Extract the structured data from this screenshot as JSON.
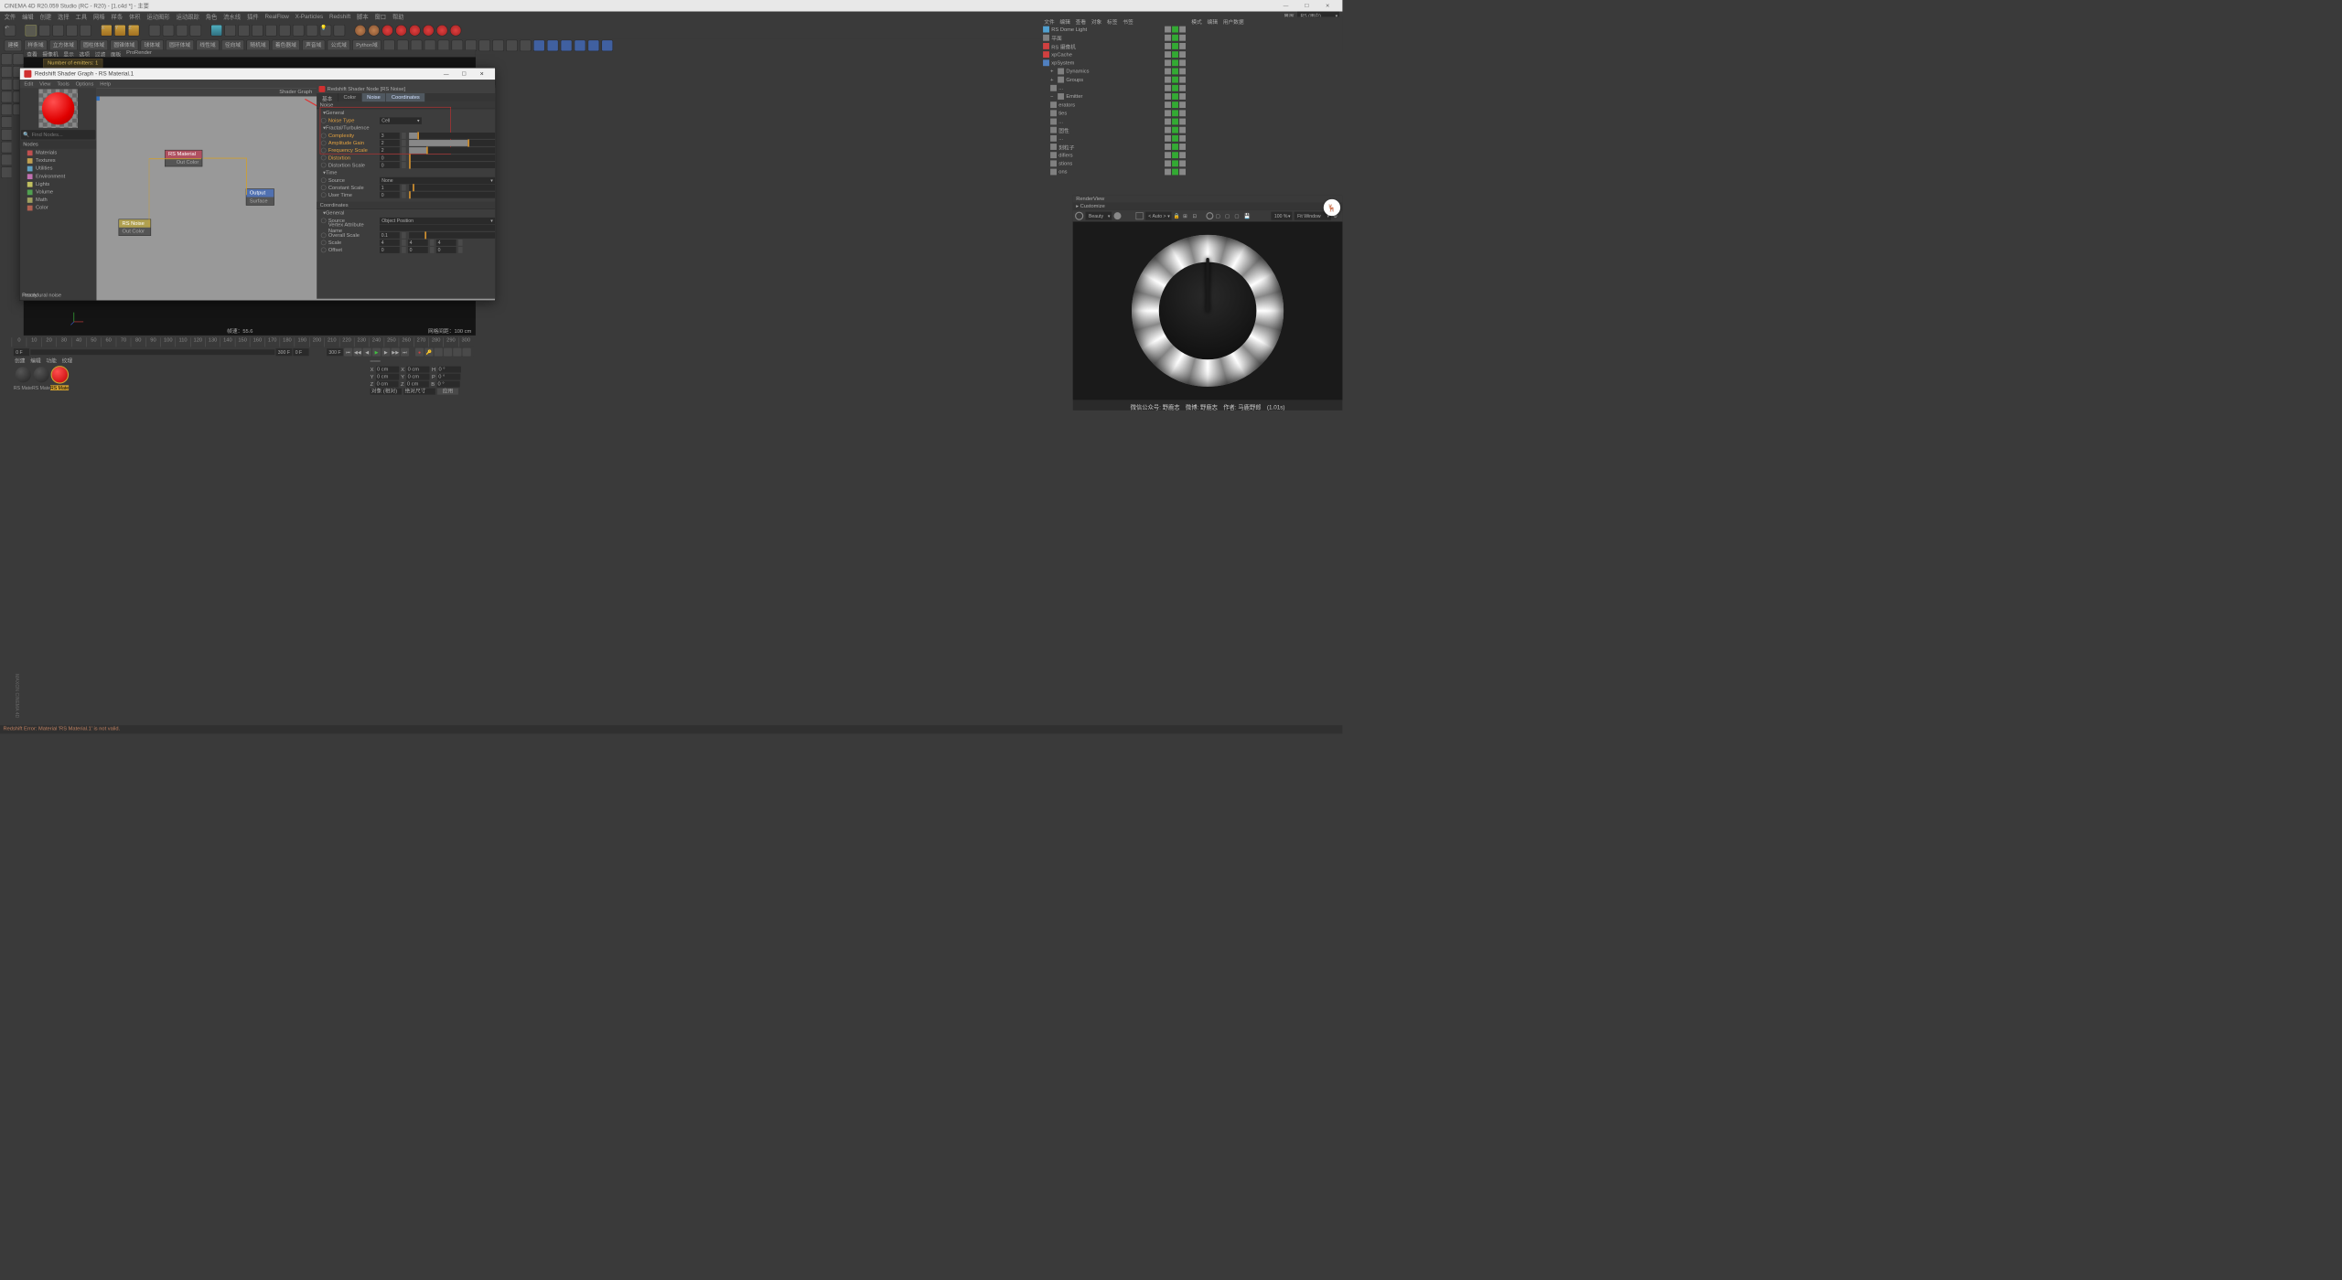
{
  "app": {
    "title": "CINEMA 4D R20.059 Studio (RC - R20) - [1.c4d *] - 主要",
    "layout_label": "界面",
    "layout_value": "RS (用户)"
  },
  "main_menu": [
    "文件",
    "编辑",
    "创建",
    "选择",
    "工具",
    "网格",
    "样条",
    "体积",
    "运动图形",
    "运动跟踪",
    "角色",
    "流水线",
    "插件",
    "RealFlow",
    "X-Particles",
    "Redshift",
    "脚本",
    "窗口",
    "帮助"
  ],
  "palette_row": [
    "建模",
    "样条域",
    "立方体域",
    "圆柱体域",
    "圆锥体域",
    "球体域",
    "圆环体域",
    "线性域",
    "径向域",
    "随机域",
    "着色器域",
    "声音域",
    "公式域",
    "Python域"
  ],
  "viewport": {
    "menu": [
      "查看",
      "摄像机",
      "显示",
      "选项",
      "过滤",
      "面板",
      "ProRender"
    ],
    "banner": "Number of emitters: 1",
    "fps": "帧速：55.6",
    "grid": "网格间距：100 cm",
    "axis_x": "X",
    "axis_y": "Y",
    "axis_z": "Z"
  },
  "shader": {
    "title": "Redshift Shader Graph - RS Material.1",
    "menu": [
      "Edit",
      "View",
      "Tools",
      "Options",
      "Help"
    ],
    "find_label": "Find Nodes...",
    "nodes_header": "Nodes",
    "categories": [
      {
        "label": "Materials",
        "color": "#c05050"
      },
      {
        "label": "Textures",
        "color": "#c0a050"
      },
      {
        "label": "Utilities",
        "color": "#60a0c0"
      },
      {
        "label": "Environment",
        "color": "#c070b0"
      },
      {
        "label": "Lights",
        "color": "#c0c060"
      },
      {
        "label": "Volume",
        "color": "#50a050"
      },
      {
        "label": "Math",
        "color": "#a0a060"
      },
      {
        "label": "Color",
        "color": "#b06050"
      }
    ],
    "graph_title": "Shader Graph",
    "nodes": {
      "rsnoise": {
        "title": "RS Noise",
        "out": "Out Color"
      },
      "rsmat": {
        "title": "RS Material",
        "out": "Out Color"
      },
      "output": {
        "title": "Output",
        "in": "Surface"
      }
    },
    "procedural": "Procedural noise",
    "ready": "Ready"
  },
  "node_panel": {
    "title": "Redshift Shader Node [RS Noise]",
    "tabs": [
      "基本",
      "Color",
      "Noise",
      "Coordinates"
    ],
    "active_tabs": [
      "Noise",
      "Coordinates"
    ],
    "noise_header": "Noise",
    "general": "General",
    "noise_type_label": "Noise Type",
    "noise_type": "Cell",
    "fractal_header": "Fractal/Turbulence",
    "complexity_label": "Complexity",
    "complexity": "3",
    "amp_gain_label": "Amplitude Gain",
    "amp_gain": "2",
    "freq_scale_label": "Frequency Scale",
    "freq_scale": "2",
    "distortion_label": "Distortion",
    "distortion": "0",
    "dist_scale_label": "Distortion Scale",
    "dist_scale": "0",
    "time_header": "Time",
    "source_label": "Source",
    "source": "None",
    "const_scale_label": "Constant Scale",
    "const_scale": "1",
    "user_time_label": "User Time",
    "user_time": "0",
    "coord_header": "Coordinates",
    "coord_general": "General",
    "coord_source_label": "Source",
    "coord_source": "Object Position",
    "vattr_label": "Vertex Attribute Name",
    "vattr": "",
    "oscale_label": "Overall Scale",
    "oscale": "0.1",
    "scale_label": "Scale",
    "scale_x": "4",
    "scale_y": "4",
    "scale_z": "4",
    "offset_label": "Offset",
    "offset_x": "0",
    "offset_y": "0",
    "offset_z": "0"
  },
  "objmgr": {
    "menu": [
      "文件",
      "编辑",
      "查看",
      "对象",
      "标签",
      "书签"
    ],
    "items": [
      {
        "icon": "#50a0d0",
        "label": "RS Dome Light"
      },
      {
        "icon": "#808080",
        "label": "平面"
      },
      {
        "icon": "#d04040",
        "label": "RS 摄像机"
      },
      {
        "icon": "#d04040",
        "label": "xpCache"
      },
      {
        "icon": "#5080c0",
        "label": "xpSystem"
      },
      {
        "icon": "#808080",
        "label": "Dynamics",
        "indent": 1,
        "expand": "+"
      },
      {
        "icon": "#808080",
        "label": "Groups",
        "indent": 1,
        "expand": "+"
      },
      {
        "icon": "#808080",
        "label": "...",
        "indent": 1
      },
      {
        "icon": "#808080",
        "label": "Emitter",
        "indent": 1,
        "expand": "−"
      },
      {
        "icon": "#808080",
        "label": "erators",
        "indent": 1
      },
      {
        "icon": "#808080",
        "label": "ties",
        "indent": 1
      },
      {
        "icon": "#808080",
        "label": "...",
        "indent": 1
      },
      {
        "icon": "#808080",
        "label": "固性",
        "indent": 1
      },
      {
        "icon": "#808080",
        "label": "...",
        "indent": 1
      },
      {
        "icon": "#808080",
        "label": "刻粒子",
        "indent": 1
      },
      {
        "icon": "#808080",
        "label": "difiers",
        "indent": 1
      },
      {
        "icon": "#808080",
        "label": "stions",
        "indent": 1
      },
      {
        "icon": "#808080",
        "label": "ons",
        "indent": 1
      }
    ]
  },
  "attr": {
    "menu": [
      "模式",
      "编辑",
      "用户数据"
    ]
  },
  "renderview": {
    "header": "RenderView",
    "customize": "Customize",
    "beauty": "Beauty",
    "auto": "< Auto >",
    "zoom": "100 %",
    "fit": "Fit Window",
    "caption": "微信公众号: 野鹿志　微博: 野鹿志　作者: 马鹿野郎　(1.01s)"
  },
  "timeline": {
    "ticks": [
      "0",
      "10",
      "20",
      "30",
      "40",
      "50",
      "60",
      "70",
      "80",
      "90",
      "100",
      "110",
      "120",
      "130",
      "140",
      "150",
      "160",
      "170",
      "180",
      "190",
      "200",
      "210",
      "220",
      "230",
      "240",
      "250",
      "260",
      "270",
      "280",
      "290",
      "300"
    ],
    "start": "0 F",
    "end": "300 F",
    "cur": "0 F",
    "range_end": "300 F"
  },
  "matmgr": {
    "menu": [
      "创建",
      "编辑",
      "功能",
      "纹理"
    ],
    "mats": [
      {
        "label": "RS Mate",
        "color": "radial-gradient(circle at 35% 30%,#555,#222)"
      },
      {
        "label": "RS Mate",
        "color": "radial-gradient(circle at 35% 30%,#555,#222)"
      },
      {
        "label": "RS Mate",
        "color": "radial-gradient(circle at 35% 30%,#ff5050,#c00000)",
        "sel": true
      }
    ]
  },
  "coord": {
    "x": "X",
    "y": "Y",
    "z": "Z",
    "xv": "0 cm",
    "yv": "0 cm",
    "zv": "0 cm",
    "xr": "0 cm",
    "yr": "0 cm",
    "zr": "0 cm",
    "h": "H",
    "p": "P",
    "b": "B",
    "hv": "0 °",
    "pv": "0 °",
    "bv": "0 °",
    "mode": "对象 (相对)",
    "abs": "绝对尺寸",
    "apply": "应用"
  },
  "status": "Redshift Error: Material 'RS Material.1' is not valid.",
  "maxon": "MAXON CINEMA 4D"
}
